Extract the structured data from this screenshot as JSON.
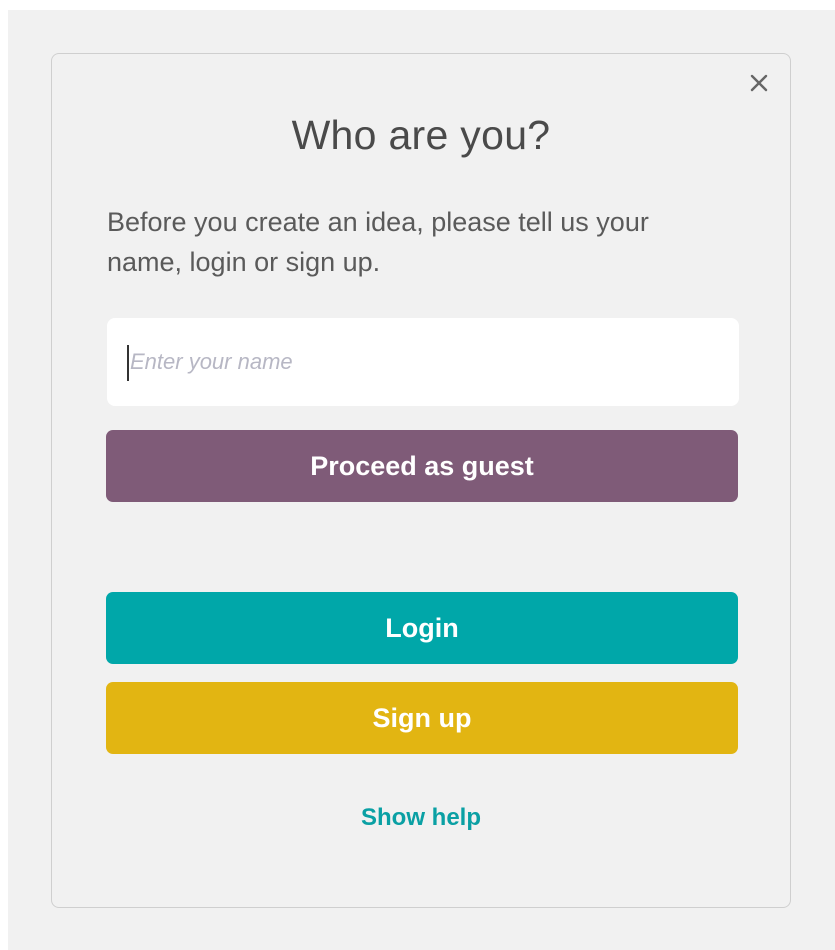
{
  "dialog": {
    "title": "Who are you?",
    "description": "Before you create an idea, please tell us your name, login or sign up.",
    "name_input": {
      "value": "",
      "placeholder": "Enter your name"
    },
    "guest_button_label": "Proceed as guest",
    "login_button_label": "Login",
    "signup_button_label": "Sign up",
    "help_link_label": "Show help",
    "close_icon": "close-icon"
  },
  "colors": {
    "guest": "#7f5b78",
    "login": "#00a7a9",
    "signup": "#e2b512",
    "help_link": "#0aa0a4",
    "title_text": "#4a4a4a"
  }
}
